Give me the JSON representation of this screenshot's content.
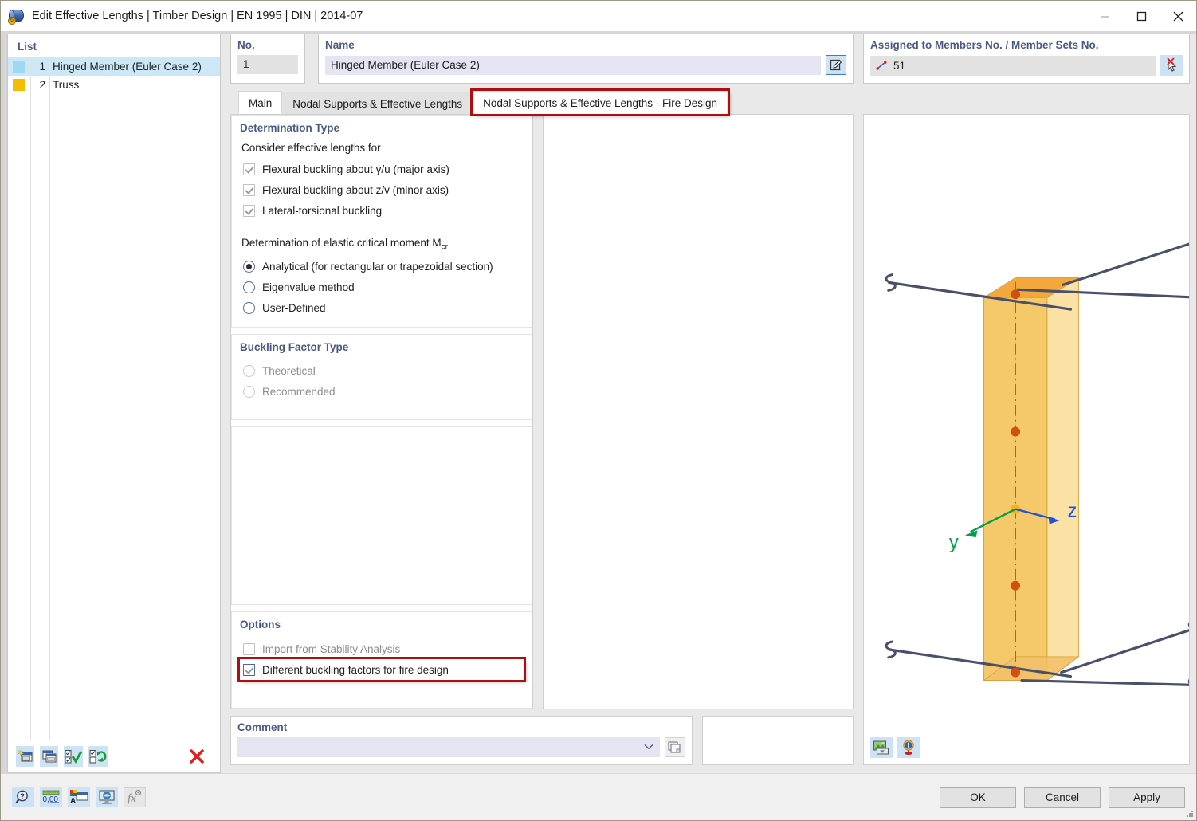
{
  "window": {
    "title": "Edit Effective Lengths | Timber Design | EN 1995 | DIN | 2014-07",
    "app_icon": "cylinder-timber-icon",
    "badge": "6",
    "minimize": "minimize-icon",
    "maximize": "maximize-icon",
    "close": "close-icon"
  },
  "list_panel": {
    "title": "List",
    "rows": [
      {
        "num": "1",
        "label": "Hinged Member (Euler Case 2)",
        "color": "#9fd9f0",
        "selected": true
      },
      {
        "num": "2",
        "label": "Truss",
        "color": "#f5bd00",
        "selected": false
      }
    ],
    "toolbar": [
      {
        "name": "new-item-button",
        "icon": "new-window-icon"
      },
      {
        "name": "copy-item-button",
        "icon": "copy-window-icon"
      },
      {
        "name": "select-all-button",
        "icon": "check-all-icon"
      },
      {
        "name": "invert-selection-button",
        "icon": "invert-selection-icon"
      },
      {
        "name": "delete-item-button",
        "icon": "red-x-icon"
      }
    ]
  },
  "header": {
    "no_label": "No.",
    "no_value": "1",
    "name_label": "Name",
    "name_value": "Hinged Member (Euler Case 2)",
    "name_edit_icon": "edit-pencil-icon"
  },
  "tabs": [
    {
      "label": "Main",
      "state": "normal"
    },
    {
      "label": "Nodal Supports & Effective Lengths",
      "state": "normal"
    },
    {
      "label": "Nodal Supports & Effective Lengths - Fire Design",
      "state": "highlighted"
    }
  ],
  "determination_type": {
    "title": "Determination Type",
    "consider_label": "Consider effective lengths for",
    "checkboxes": [
      {
        "label": "Flexural buckling about y/u (major axis)",
        "checked": true,
        "enabled": false
      },
      {
        "label": "Flexural buckling about z/v (minor axis)",
        "checked": true,
        "enabled": false
      },
      {
        "label": "Lateral-torsional buckling",
        "checked": true,
        "enabled": false
      }
    ],
    "mcr_label": "Determination of elastic critical moment Mcr",
    "mcr_label_main": "Determination of elastic critical moment M",
    "mcr_label_sub": "cr",
    "radios": [
      {
        "label": "Analytical (for rectangular or trapezoidal section)",
        "checked": true,
        "enabled": true
      },
      {
        "label": "Eigenvalue method",
        "checked": false,
        "enabled": true
      },
      {
        "label": "User-Defined",
        "checked": false,
        "enabled": true
      }
    ]
  },
  "buckling_factor_type": {
    "title": "Buckling Factor Type",
    "radios": [
      {
        "label": "Theoretical",
        "checked": false,
        "enabled": false
      },
      {
        "label": "Recommended",
        "checked": false,
        "enabled": false
      }
    ]
  },
  "options": {
    "title": "Options",
    "checkboxes": [
      {
        "label": "Import from Stability Analysis",
        "checked": false,
        "enabled": false,
        "highlighted": false
      },
      {
        "label": "Different buckling factors for fire design",
        "checked": true,
        "enabled": true,
        "highlighted": true
      }
    ]
  },
  "comment": {
    "title": "Comment",
    "value": "",
    "placeholder": "",
    "dropdown_icon": "chevron-down-icon",
    "button_icon": "copy-pages-icon"
  },
  "assigned": {
    "title": "Assigned to Members No. / Member Sets No.",
    "value": "51",
    "prefix_icon": "member-line-icon",
    "pick_icon": "pick-cursor-icon"
  },
  "viewport": {
    "axis_y": "y",
    "axis_z": "z",
    "tools": [
      {
        "name": "render-mode-button",
        "icon": "render-image-icon"
      },
      {
        "name": "info-button",
        "icon": "info-pin-icon"
      }
    ],
    "colors": {
      "member_front": "#f5c96a",
      "member_side": "#fbe1a4",
      "member_top": "#f3a83c",
      "support": "#4a4f6b",
      "node": "#d2500f",
      "axis_y": "#00a04a",
      "axis_z": "#1f50d8"
    }
  },
  "footer": {
    "tools": [
      {
        "name": "help-button",
        "icon": "help-magnifier-icon"
      },
      {
        "name": "units-button",
        "icon": "units-000-icon"
      },
      {
        "name": "display-properties-button",
        "icon": "color-palette-icon"
      },
      {
        "name": "graphic-settings-button",
        "icon": "screen-globe-icon"
      },
      {
        "name": "formula-button",
        "icon": "fx-icon"
      }
    ],
    "buttons": [
      {
        "label": "OK",
        "name": "ok-button"
      },
      {
        "label": "Cancel",
        "name": "cancel-button"
      },
      {
        "label": "Apply",
        "name": "apply-button"
      }
    ]
  },
  "colors": {
    "accent": "#4a5a84",
    "highlight_red": "#b10d10",
    "selection_blue": "#cce8f6",
    "field_gray": "#e2e2e2",
    "field_lavender": "#e4e4f2"
  }
}
